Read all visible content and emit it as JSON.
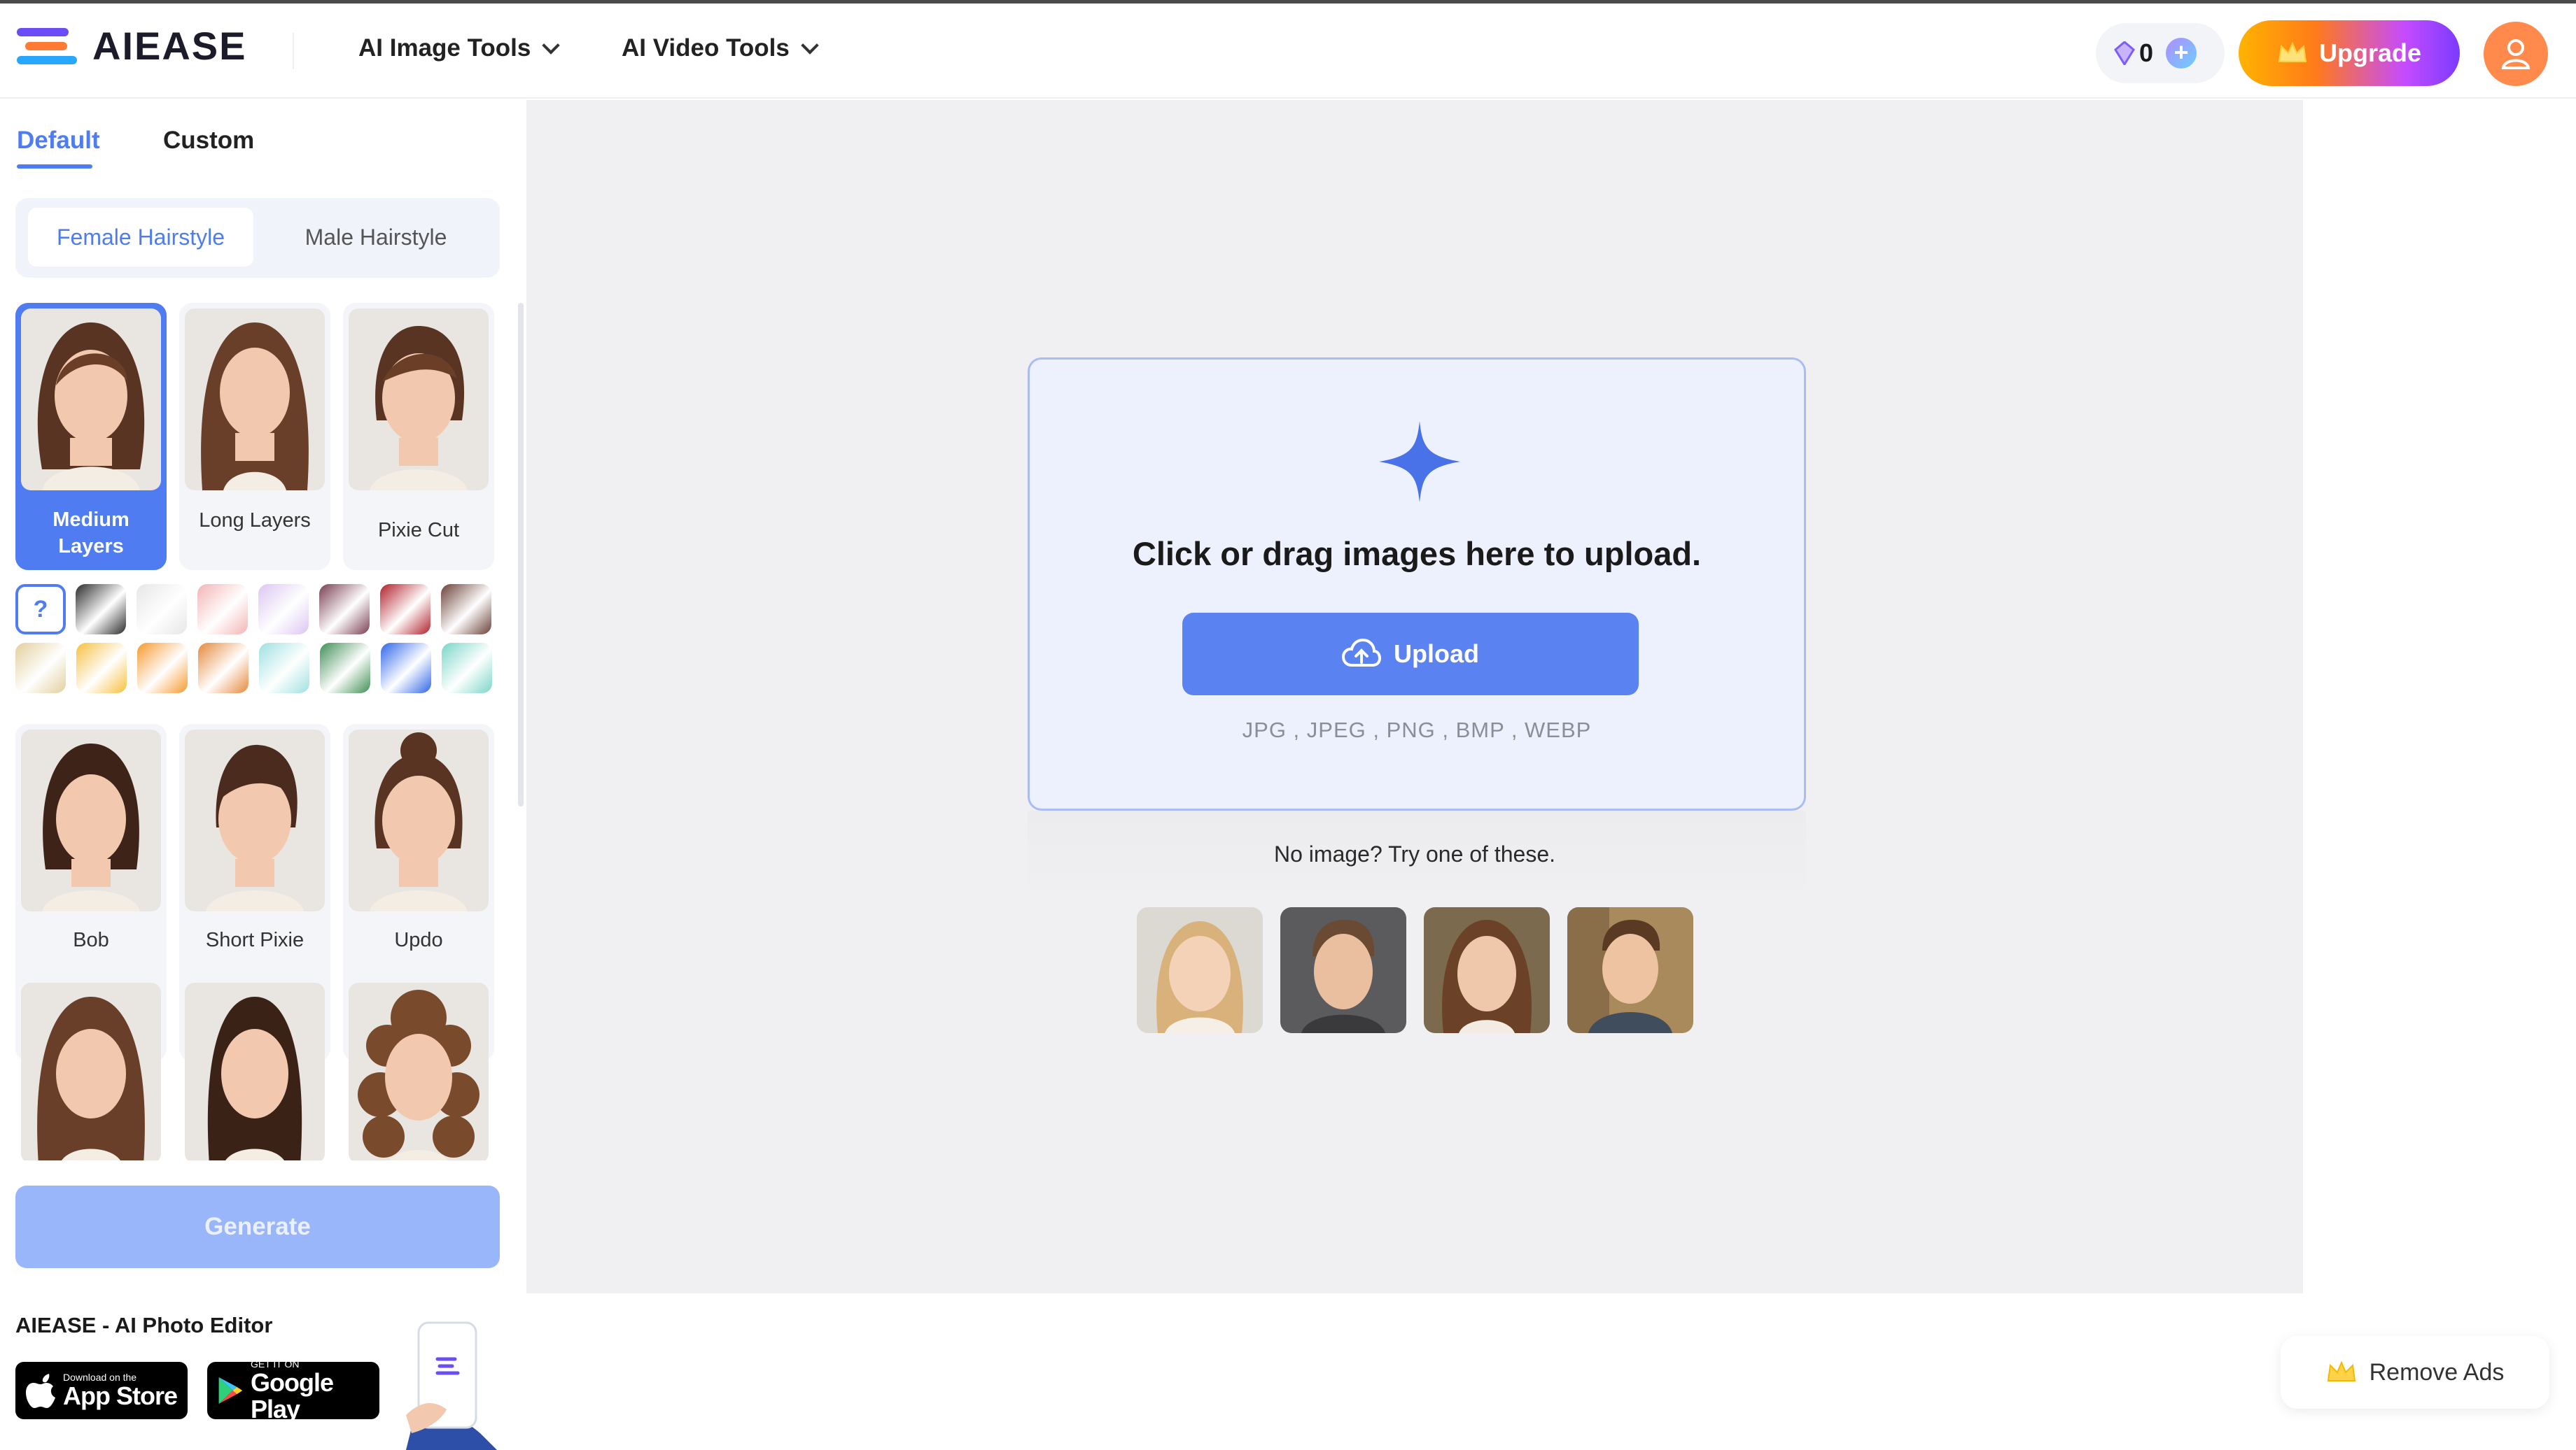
{
  "header": {
    "brand": "AIEASE",
    "nav": [
      {
        "label": "AI Image Tools"
      },
      {
        "label": "AI Video Tools"
      }
    ],
    "credits": "0",
    "upgrade_label": "Upgrade"
  },
  "sidebar": {
    "tabs": [
      {
        "label": "Default",
        "active": true
      },
      {
        "label": "Custom",
        "active": false
      }
    ],
    "gender": [
      {
        "label": "Female Hairstyle",
        "active": true
      },
      {
        "label": "Male Hairstyle",
        "active": false
      }
    ],
    "styles_row1": [
      {
        "label": "Medium Layers",
        "selected": true
      },
      {
        "label": "Long Layers",
        "selected": false
      },
      {
        "label": "Pixie Cut",
        "selected": false
      }
    ],
    "styles_row2": [
      {
        "label": "Bob"
      },
      {
        "label": "Short Pixie"
      },
      {
        "label": "Updo"
      }
    ],
    "swatch_question": "?",
    "colors_row1": [
      "#2b2b2b",
      "#e6e6e8",
      "#f4b4b4",
      "#dcc6f2",
      "#7a3e52",
      "#b0202a",
      "#6b4036"
    ],
    "colors_row2": [
      "#e3cf9d",
      "#f6c03c",
      "#f59a2c",
      "#e58a3a",
      "#9fe0e0",
      "#3f8f55",
      "#2f66e8",
      "#7ad6c8"
    ],
    "generate_label": "Generate",
    "app_title": "AIEASE - AI Photo Editor",
    "app_store": {
      "small": "Download on the",
      "big": "App Store"
    },
    "google_play": {
      "small": "GET IT ON",
      "big": "Google Play"
    }
  },
  "main": {
    "upload_title": "Click or drag images here to upload.",
    "upload_button": "Upload",
    "formats": "JPG , JPEG , PNG , BMP , WEBP",
    "no_image_text": "No image? Try one of these."
  },
  "remove_ads_label": "Remove Ads",
  "colors": {
    "accent": "#4f7cf0",
    "upload_button": "#5a82f0",
    "generate_disabled": "#9ab6fb",
    "avatar": "#ff8a4c"
  }
}
